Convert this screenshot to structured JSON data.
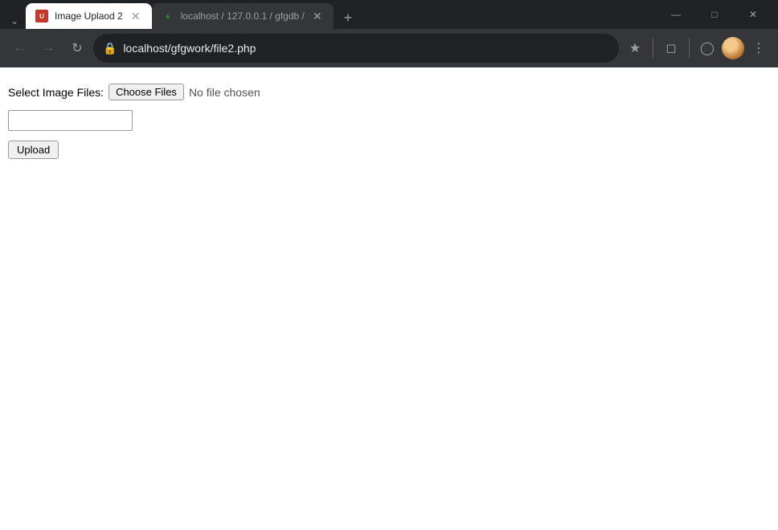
{
  "browser": {
    "tabs": [
      {
        "id": "tab-1",
        "title": "Image Uplaod 2",
        "favicon_type": "upload",
        "active": true,
        "url": "localhost/gfgwork/file2.php"
      },
      {
        "id": "tab-2",
        "title": "localhost / 127.0.0.1 / gfgdb /",
        "favicon_type": "gfg",
        "active": false,
        "url": ""
      }
    ],
    "address": "localhost/gfgwork/file2.php",
    "window_controls": {
      "minimize": "—",
      "maximize": "□",
      "close": "✕"
    }
  },
  "page": {
    "label": "Select Image Files:",
    "choose_files_btn": "Choose Files",
    "no_file_text": "No file chosen",
    "text_input_placeholder": "",
    "upload_btn": "Upload"
  }
}
